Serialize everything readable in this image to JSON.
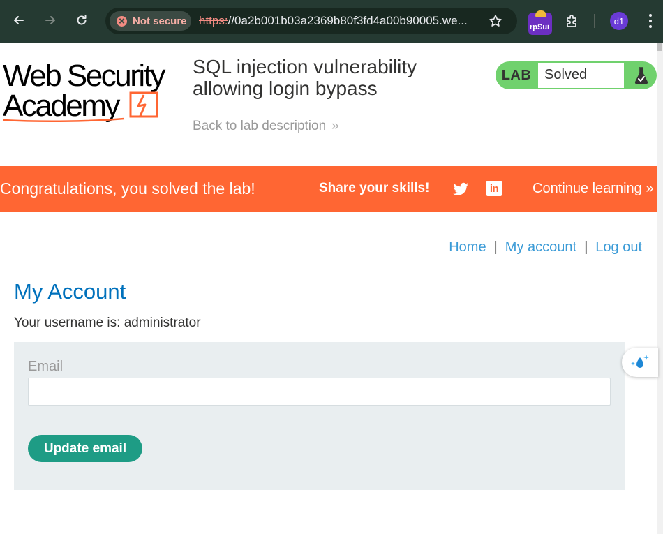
{
  "browser": {
    "security_label": "Not secure",
    "url_scheme": "https:",
    "url_rest": "//0a2b001b03a2369b80f3fd4a00b90005.we...",
    "extension_label": "rpSui",
    "profile_initials": "d1"
  },
  "lab": {
    "logo_line1": "Web Security",
    "logo_line2": "Academy",
    "title": "SQL injection vulnerability allowing login bypass",
    "back_link": "Back to lab description",
    "status_prefix": "LAB",
    "status": "Solved"
  },
  "banner": {
    "congrats": "Congratulations, you solved the lab!",
    "share": "Share your skills!",
    "linkedin_label": "in",
    "continue": "Continue learning"
  },
  "nav": {
    "home": "Home",
    "my_account": "My account",
    "log_out": "Log out",
    "separator": "|"
  },
  "account": {
    "heading": "My Account",
    "username_text": "Your username is: administrator",
    "email_label": "Email",
    "email_value": "",
    "update_button": "Update email"
  },
  "colors": {
    "chrome_bg": "#253a32",
    "banner": "#ff6633",
    "lab_green": "#70d16d",
    "heading_blue": "#0071bc",
    "link_blue": "#3b9bd7",
    "button_teal": "#1e9c85",
    "panel_bg": "#e9eef0"
  },
  "icons": [
    "back-arrow-icon",
    "forward-arrow-icon",
    "reload-icon",
    "warning-icon",
    "star-icon",
    "puzzle-icon",
    "kebab-menu-icon",
    "flask-icon",
    "twitter-icon",
    "linkedin-icon",
    "double-chevron-icon",
    "sparkle-drop-icon"
  ]
}
